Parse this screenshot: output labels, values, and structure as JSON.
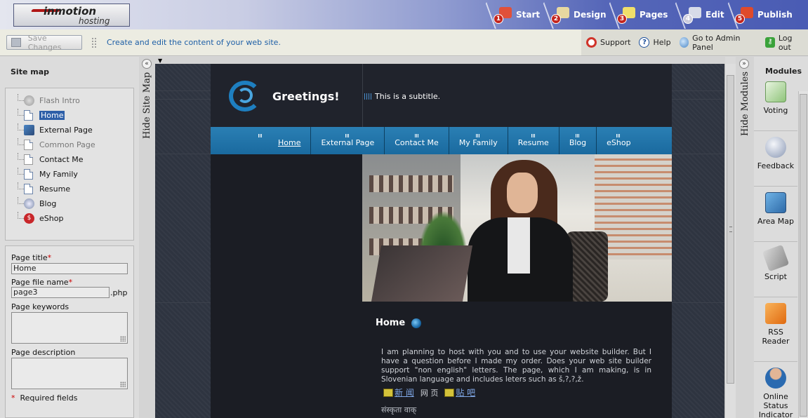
{
  "brand": {
    "name": "inmotion",
    "sub": "hosting"
  },
  "steps": [
    {
      "num": "1",
      "label": "Start"
    },
    {
      "num": "2",
      "label": "Design"
    },
    {
      "num": "3",
      "label": "Pages"
    },
    {
      "num": "4",
      "label": "Edit"
    },
    {
      "num": "5",
      "label": "Publish"
    }
  ],
  "toolbar": {
    "save_label": "Save Changes",
    "hint": "Create and edit the content of your web site.",
    "support": "Support",
    "help": "Help",
    "admin": "Go to Admin Panel",
    "logout": "Log out"
  },
  "sitemap": {
    "title": "Site map",
    "hide_label": "Hide Site Map",
    "items": [
      {
        "label": "Flash Intro"
      },
      {
        "label": "Home"
      },
      {
        "label": "External Page"
      },
      {
        "label": "Common Page"
      },
      {
        "label": "Contact Me"
      },
      {
        "label": "My Family"
      },
      {
        "label": "Resume"
      },
      {
        "label": "Blog"
      },
      {
        "label": "eShop"
      }
    ]
  },
  "props": {
    "title_label": "Page title",
    "title_value": "Home",
    "file_label": "Page file name",
    "file_value": "page3",
    "file_ext": ".php",
    "keywords_label": "Page keywords",
    "description_label": "Page description",
    "required_note": "Required fields",
    "star": "*"
  },
  "site": {
    "title": "Greetings!",
    "subtitle": "This is a subtitle.",
    "nav": [
      "Home",
      "External Page",
      "Contact Me",
      "My Family",
      "Resume",
      "Blog",
      "eShop"
    ],
    "page_heading": "Home",
    "body_text": "I am planning to host with you and to use your website builder. But I have a question before I made my order. Does your web site builder support \"non english\" letters. The page, which I am making, is in Slovenian language and includes leters such as š,?,?,ž.",
    "cn_link1": "新 闻",
    "cn_plain": "网 页",
    "cn_link2": "贴 吧",
    "hindi": "संस्कृता वाक्"
  },
  "modules": {
    "title": "Modules",
    "hide_label": "Hide Modules",
    "items": [
      {
        "label": "Voting"
      },
      {
        "label": "Feedback"
      },
      {
        "label": "Area Map"
      },
      {
        "label": "Script"
      },
      {
        "label": "RSS Reader"
      },
      {
        "label": "Online Status Indicator"
      }
    ]
  },
  "colors": {
    "accent": "#1e5fa6",
    "nav": "#2a7fb4",
    "required": "#cc0000"
  }
}
